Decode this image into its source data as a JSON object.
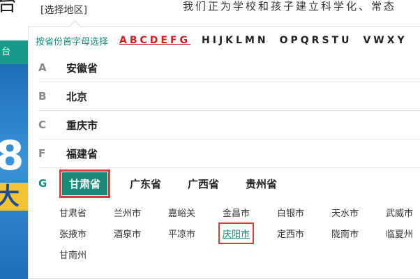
{
  "header": {
    "logo_fragment": "台",
    "region_trigger": "[选择地区]",
    "slogan": "我们正为学校和孩子建立科学化、常态"
  },
  "side": {
    "nav_text": "台",
    "banner_digit": "8",
    "banner_char": "大"
  },
  "letters": {
    "hint": "按省份首字母选择",
    "groups": [
      {
        "label": "ABCDEFG",
        "active": true
      },
      {
        "label": "HIJKLMN",
        "active": false
      },
      {
        "label": "OPQRSTU",
        "active": false
      },
      {
        "label": "VWXY",
        "active": false
      }
    ]
  },
  "rows": [
    {
      "letter": "A",
      "provinces": [
        "安徽省"
      ]
    },
    {
      "letter": "B",
      "provinces": [
        "北京"
      ]
    },
    {
      "letter": "C",
      "provinces": [
        "重庆市"
      ]
    },
    {
      "letter": "F",
      "provinces": [
        "福建省"
      ]
    },
    {
      "letter": "G",
      "provinces": [
        "甘肃省",
        "广东省",
        "广西省",
        "贵州省"
      ],
      "selected_province": "甘肃省"
    }
  ],
  "cities": [
    "甘肃省",
    "兰州市",
    "嘉峪关",
    "金昌市",
    "白银市",
    "天水市",
    "武威市",
    "张掖市",
    "酒泉市",
    "平凉市",
    "庆阳市",
    "定西市",
    "陇南市",
    "临夏州",
    "甘南州"
  ],
  "highlighted_city": "庆阳市",
  "colors": {
    "accent": "#1a8a7a",
    "active_letters": "#cc1f1f",
    "highlight_box": "#e03a3a"
  }
}
